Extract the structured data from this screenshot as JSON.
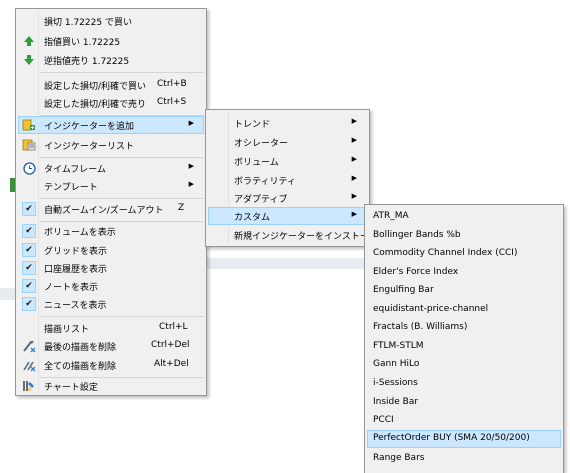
{
  "main_menu": {
    "items": [
      {
        "label": "損切 1.72225 で買い",
        "icon": "none"
      },
      {
        "label": "指値買い 1.72225",
        "icon": "up-arrow-green-icon"
      },
      {
        "label": "逆指値売り 1.72225",
        "icon": "down-arrow-green-icon"
      },
      {
        "label": "設定した損切/利確で買い",
        "shortcut": "Ctrl+B"
      },
      {
        "label": "設定した損切/利確で売り",
        "shortcut": "Ctrl+S"
      },
      {
        "label": "インジケーターを追加",
        "icon": "add-indicator-icon",
        "submenu": true,
        "highlighted": true
      },
      {
        "label": "インジケーターリスト",
        "icon": "indicator-list-icon"
      },
      {
        "label": "タイムフレーム",
        "icon": "clock-icon",
        "submenu": true
      },
      {
        "label": "テンプレート",
        "submenu": true
      },
      {
        "label": "自動ズームイン/ズームアウト",
        "shortcut": "Z",
        "checked": true
      },
      {
        "label": "ボリュームを表示",
        "checked": true
      },
      {
        "label": "グリッドを表示",
        "checked": true
      },
      {
        "label": "口座履歴を表示",
        "checked": true
      },
      {
        "label": "ノートを表示",
        "checked": true
      },
      {
        "label": "ニュースを表示",
        "checked": true
      },
      {
        "label": "描画リスト",
        "shortcut": "Ctrl+L"
      },
      {
        "label": "最後の描画を削除",
        "shortcut": "Ctrl+Del",
        "icon": "delete-last-drawing-icon"
      },
      {
        "label": "全ての描画を削除",
        "shortcut": "Alt+Del",
        "icon": "delete-all-drawings-icon"
      },
      {
        "label": "チャート設定",
        "icon": "chart-settings-icon"
      }
    ]
  },
  "indicator_submenu": {
    "items": [
      {
        "label": "トレンド",
        "submenu": true
      },
      {
        "label": "オシレーター",
        "submenu": true
      },
      {
        "label": "ボリューム",
        "submenu": true
      },
      {
        "label": "ボラティリティ",
        "submenu": true
      },
      {
        "label": "アダプティブ",
        "submenu": true
      },
      {
        "label": "カスタム",
        "submenu": true,
        "highlighted": true
      },
      {
        "label": "新規インジケーターをインストール"
      }
    ]
  },
  "custom_submenu": {
    "items": [
      "ATR_MA",
      "Bollinger Bands %b",
      "Commodity Channel Index (CCI)",
      "Elder's Force Index",
      "Engulfing Bar",
      "equidistant-price-channel",
      "Fractals (B. Williams)",
      "FTLM-STLM",
      "Gann HiLo",
      "i-Sessions",
      "Inside Bar",
      "PCCI",
      "PerfectOrder BUY (SMA 20/50/200)",
      "Range Bars"
    ],
    "highlighted_index": 12
  },
  "colors": {
    "menu_bg": "#f0f0f0",
    "highlight": "#cce8ff",
    "highlight_border": "#99d1ff",
    "arrow_green": "#2e9e3e"
  }
}
